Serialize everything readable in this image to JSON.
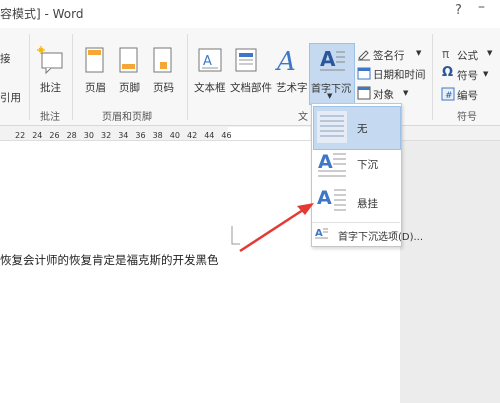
{
  "window": {
    "title": "容模式] - Word",
    "help": "?",
    "minimize": "–"
  },
  "ribbon": {
    "left_cut": {
      "top": "接",
      "bottom": "引用"
    },
    "comment": {
      "button": "批注",
      "group": "批注"
    },
    "header_footer": {
      "header": "页眉",
      "footer": "页脚",
      "page_number": "页码",
      "group": "页眉和页脚"
    },
    "text": {
      "textbox": "文本框",
      "quick_parts": "文档部件",
      "wordart": "艺术字",
      "dropcap": "首字下沉",
      "group": "文"
    },
    "text_small": {
      "signature": "签名行",
      "datetime": "日期和时间",
      "object": "对象"
    },
    "symbols": {
      "equation": "公式",
      "symbol": "符号",
      "numbering": "编号",
      "group": "符号"
    }
  },
  "ruler": {
    "ticks": [
      "22",
      "24",
      "26",
      "28",
      "30",
      "32",
      "34",
      "36",
      "38",
      "40",
      "42",
      "44",
      "46"
    ]
  },
  "document": {
    "text": "恢复会计师的恢复肯定是福克斯的开发黑色"
  },
  "dropcap_menu": {
    "none": "无",
    "dropped": "下沉",
    "in_margin": "悬挂",
    "options": "首字下沉选项(D)..."
  },
  "colors": {
    "accent": "#2b579a",
    "selection": "#c5daf1",
    "arrow": "#e53935",
    "icon_blue": "#3e77c7"
  }
}
